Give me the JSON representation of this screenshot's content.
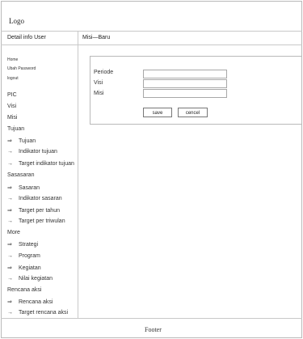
{
  "header": {
    "logo": "Logo"
  },
  "topbar": {
    "left": "Detail info User",
    "right": "Misi—Baru"
  },
  "sidebar": {
    "user_links": [
      "Home",
      "Ubah Password",
      "logout"
    ],
    "items": [
      {
        "label": "PIC",
        "arrow": ""
      },
      {
        "label": "Visi",
        "arrow": ""
      },
      {
        "label": "Misi",
        "arrow": ""
      },
      {
        "label": "Tujuan",
        "arrow": ""
      },
      {
        "label": "Tujuan",
        "arrow": "⇒"
      },
      {
        "label": "Indikator tujuan",
        "arrow": "→"
      },
      {
        "label": "Target indikator tujuan",
        "arrow": "→"
      },
      {
        "label": "Sasasaran",
        "arrow": ""
      },
      {
        "label": "Sasaran",
        "arrow": "⇒"
      },
      {
        "label": "Indikator sasaran",
        "arrow": "→"
      },
      {
        "label": "Target per tahun",
        "arrow": "⇒"
      },
      {
        "label": "Target per triwulan",
        "arrow": "→"
      },
      {
        "label": "More",
        "arrow": ""
      },
      {
        "label": "Strategi",
        "arrow": "⇒"
      },
      {
        "label": "Program",
        "arrow": "→"
      },
      {
        "label": "Kegiatan",
        "arrow": "⇒"
      },
      {
        "label": "Nilai kegiatan",
        "arrow": "→"
      },
      {
        "label": "Rencana aksi",
        "arrow": ""
      },
      {
        "label": "Rencana aksi",
        "arrow": "⇒"
      },
      {
        "label": "Target rencana aksi",
        "arrow": "→"
      }
    ]
  },
  "form": {
    "fields": [
      {
        "label": "Periode",
        "value": ""
      },
      {
        "label": "Visi",
        "value": ""
      },
      {
        "label": "Misi",
        "value": ""
      }
    ],
    "save_label": "save",
    "cancel_label": "cencel"
  },
  "footer": {
    "text": "Footer"
  }
}
